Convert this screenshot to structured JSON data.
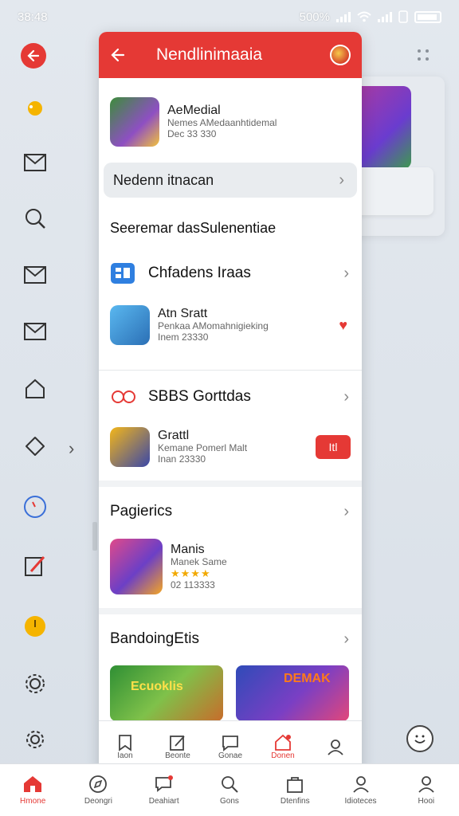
{
  "status": {
    "time": "38:48",
    "battery_text": "500%"
  },
  "header": {
    "title": "Nendlinimaaia"
  },
  "featured": {
    "title": "AeMedial",
    "subtitle": "Nemes AMedaanhtidemal",
    "meta": "Dec 33 330"
  },
  "pill": {
    "label": "Nedenn itnacan"
  },
  "heading1": "Seeremar dasSulenentiae",
  "section1": {
    "title": "Chfadens Iraas",
    "item": {
      "title": "Atn Sratt",
      "subtitle": "Penkaa AMomahnigieking",
      "meta": "Inem 23330"
    }
  },
  "section2": {
    "title": "SBBS Gorttdas",
    "item": {
      "title": "Grattl",
      "subtitle": "Kemane Pomerl Malt",
      "meta": "Inan 23330"
    },
    "button_label": "Itl"
  },
  "section3": {
    "title": "Pagierics",
    "item": {
      "title": "Manis",
      "subtitle": "Manek Same",
      "stars": "★★★★",
      "meta": "02 113333"
    }
  },
  "section4": {
    "title": "BandoingEtis",
    "banners": [
      "Ecuoklis",
      "DEMAK"
    ]
  },
  "panel_nav": [
    {
      "label": "Iaon",
      "icon": "bookmark-icon"
    },
    {
      "label": "Beonte",
      "icon": "edit-icon"
    },
    {
      "label": "Gonae",
      "icon": "chat-icon"
    },
    {
      "label": "Donen",
      "icon": "home-icon"
    },
    {
      "label": "",
      "icon": "person-icon"
    }
  ],
  "bottom_nav": [
    {
      "label": "Hmone",
      "icon": "home-icon"
    },
    {
      "label": "Deongri",
      "icon": "compass-icon"
    },
    {
      "label": "Deahiart",
      "icon": "chat-icon"
    },
    {
      "label": "Gons",
      "icon": "search-icon"
    },
    {
      "label": "Dtenfins",
      "icon": "bag-icon"
    },
    {
      "label": "Idioteces",
      "icon": "person-icon"
    },
    {
      "label": "Hooi",
      "icon": "profile-icon"
    }
  ],
  "colors": {
    "accent": "#e53935",
    "panel_bg": "#f1f3f5",
    "star": "#f2a900"
  }
}
